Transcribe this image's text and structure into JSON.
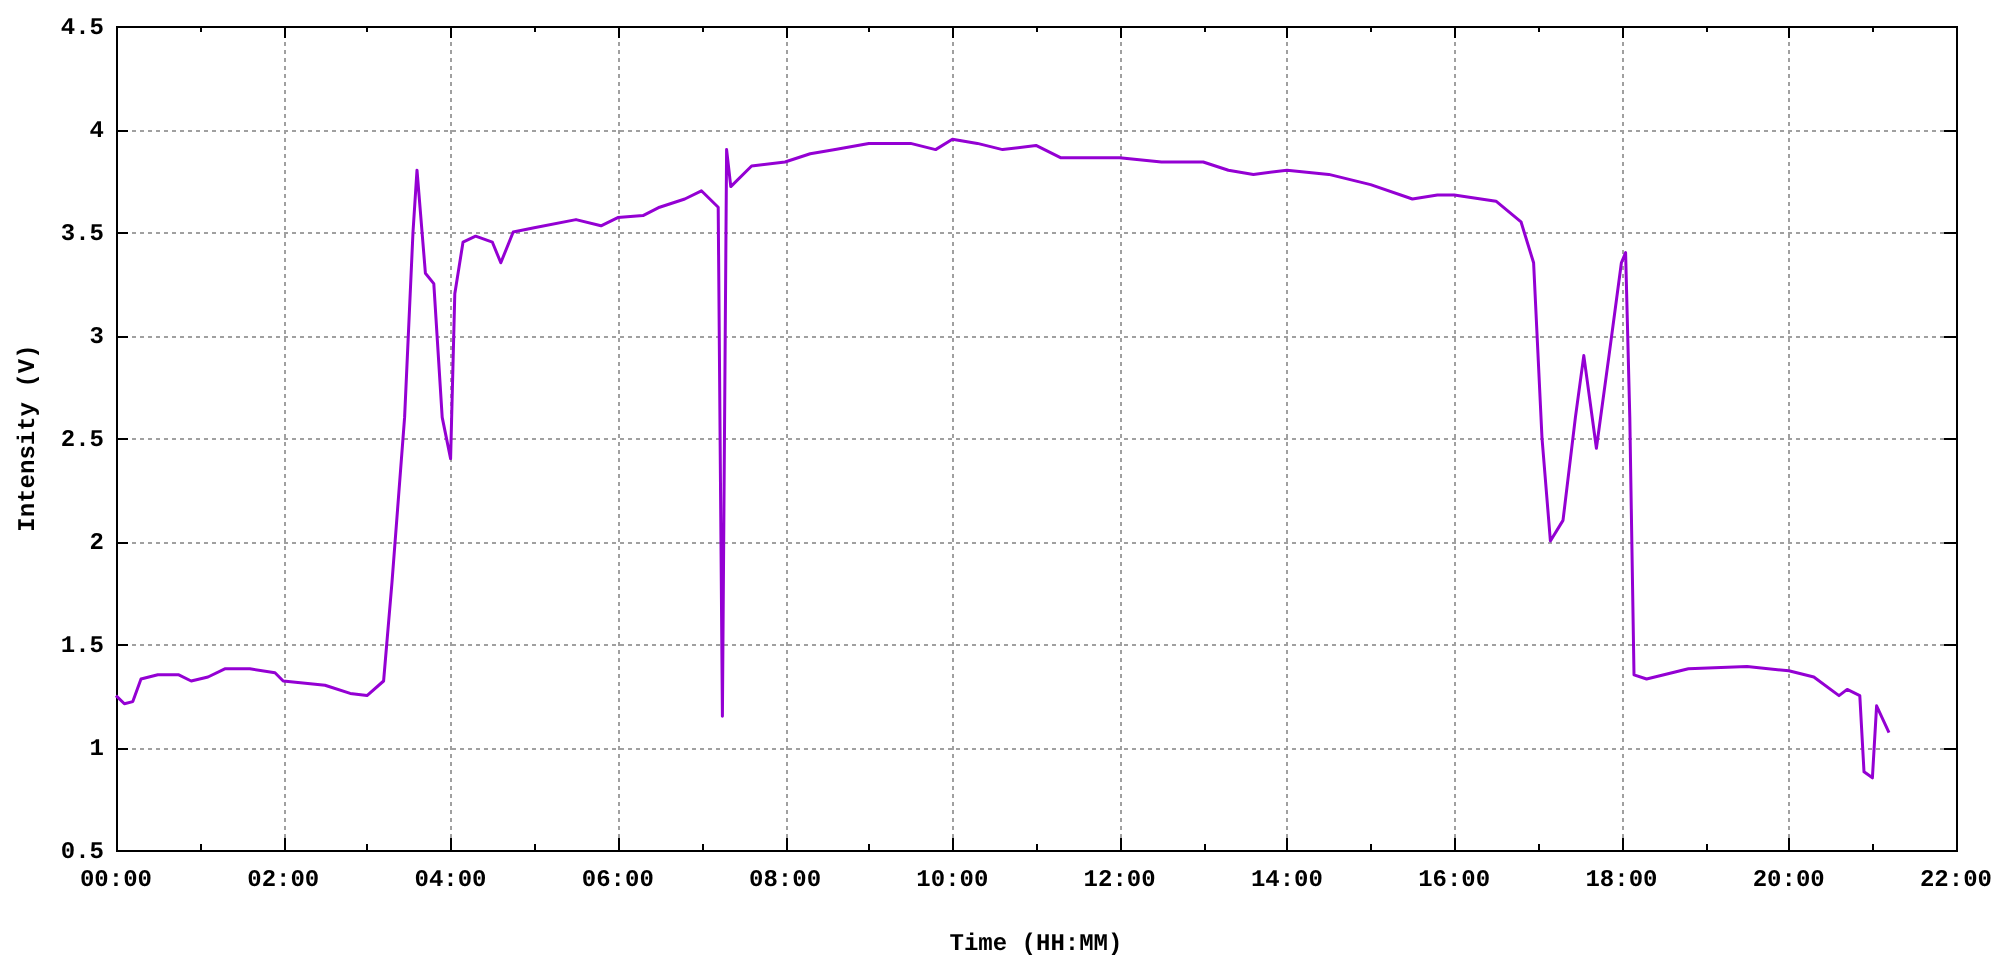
{
  "chart": {
    "chart_data": {
      "type": "line",
      "xlabel": "Time (HH:MM)",
      "ylabel": "Intensity (V)",
      "x": [
        0,
        0.1,
        0.2,
        0.3,
        0.5,
        0.75,
        0.9,
        1.1,
        1.3,
        1.6,
        1.9,
        2,
        2.5,
        2.8,
        3,
        3.2,
        3.3,
        3.45,
        3.55,
        3.6,
        3.7,
        3.8,
        3.9,
        4,
        4.05,
        4.15,
        4.3,
        4.5,
        4.6,
        4.75,
        5,
        5.5,
        5.8,
        6,
        6.3,
        6.5,
        6.8,
        7,
        7.2,
        7.25,
        7.3,
        7.35,
        7.6,
        8,
        8.3,
        8.6,
        9,
        9.5,
        9.8,
        10,
        10.3,
        10.6,
        11,
        11.3,
        12,
        12.5,
        13,
        13.3,
        13.6,
        14,
        14.5,
        15,
        15.5,
        15.8,
        16,
        16.5,
        16.8,
        16.95,
        17.05,
        17.15,
        17.3,
        17.45,
        17.55,
        17.7,
        17.85,
        18,
        18.05,
        18.1,
        18.15,
        18.3,
        18.8,
        19.5,
        20,
        20.3,
        20.6,
        20.7,
        20.85,
        20.9,
        21,
        21.05,
        21.2
      ],
      "series": [
        {
          "color": "#9400d3",
          "values": [
            1.25,
            1.21,
            1.22,
            1.33,
            1.35,
            1.35,
            1.32,
            1.34,
            1.38,
            1.38,
            1.36,
            1.32,
            1.3,
            1.26,
            1.25,
            1.32,
            1.8,
            2.6,
            3.5,
            3.8,
            3.3,
            3.25,
            2.6,
            2.4,
            3.2,
            3.45,
            3.48,
            3.45,
            3.35,
            3.5,
            3.52,
            3.56,
            3.53,
            3.57,
            3.58,
            3.62,
            3.66,
            3.7,
            3.62,
            1.15,
            3.9,
            3.72,
            3.82,
            3.84,
            3.88,
            3.9,
            3.93,
            3.93,
            3.9,
            3.95,
            3.93,
            3.9,
            3.92,
            3.86,
            3.86,
            3.84,
            3.84,
            3.8,
            3.78,
            3.8,
            3.78,
            3.73,
            3.66,
            3.68,
            3.68,
            3.65,
            3.55,
            3.35,
            2.5,
            2,
            2.1,
            2.6,
            2.9,
            2.45,
            2.9,
            3.35,
            3.4,
            2.6,
            1.35,
            1.33,
            1.38,
            1.39,
            1.37,
            1.34,
            1.25,
            1.28,
            1.25,
            0.88,
            0.85,
            1.2,
            1.07
          ]
        }
      ],
      "grid": true,
      "xlim": [
        0,
        22
      ],
      "ylim": [
        0.5,
        4.5
      ],
      "xticks": [
        {
          "value": 0,
          "label": "00:00"
        },
        {
          "value": 2,
          "label": "02:00"
        },
        {
          "value": 4,
          "label": "04:00"
        },
        {
          "value": 6,
          "label": "06:00"
        },
        {
          "value": 8,
          "label": "08:00"
        },
        {
          "value": 10,
          "label": "10:00"
        },
        {
          "value": 12,
          "label": "12:00"
        },
        {
          "value": 14,
          "label": "14:00"
        },
        {
          "value": 16,
          "label": "16:00"
        },
        {
          "value": 18,
          "label": "18:00"
        },
        {
          "value": 20,
          "label": "20:00"
        },
        {
          "value": 22,
          "label": "22:00"
        }
      ],
      "yticks": [
        0.5,
        1,
        1.5,
        2,
        2.5,
        3,
        3.5,
        4,
        4.5
      ]
    }
  }
}
